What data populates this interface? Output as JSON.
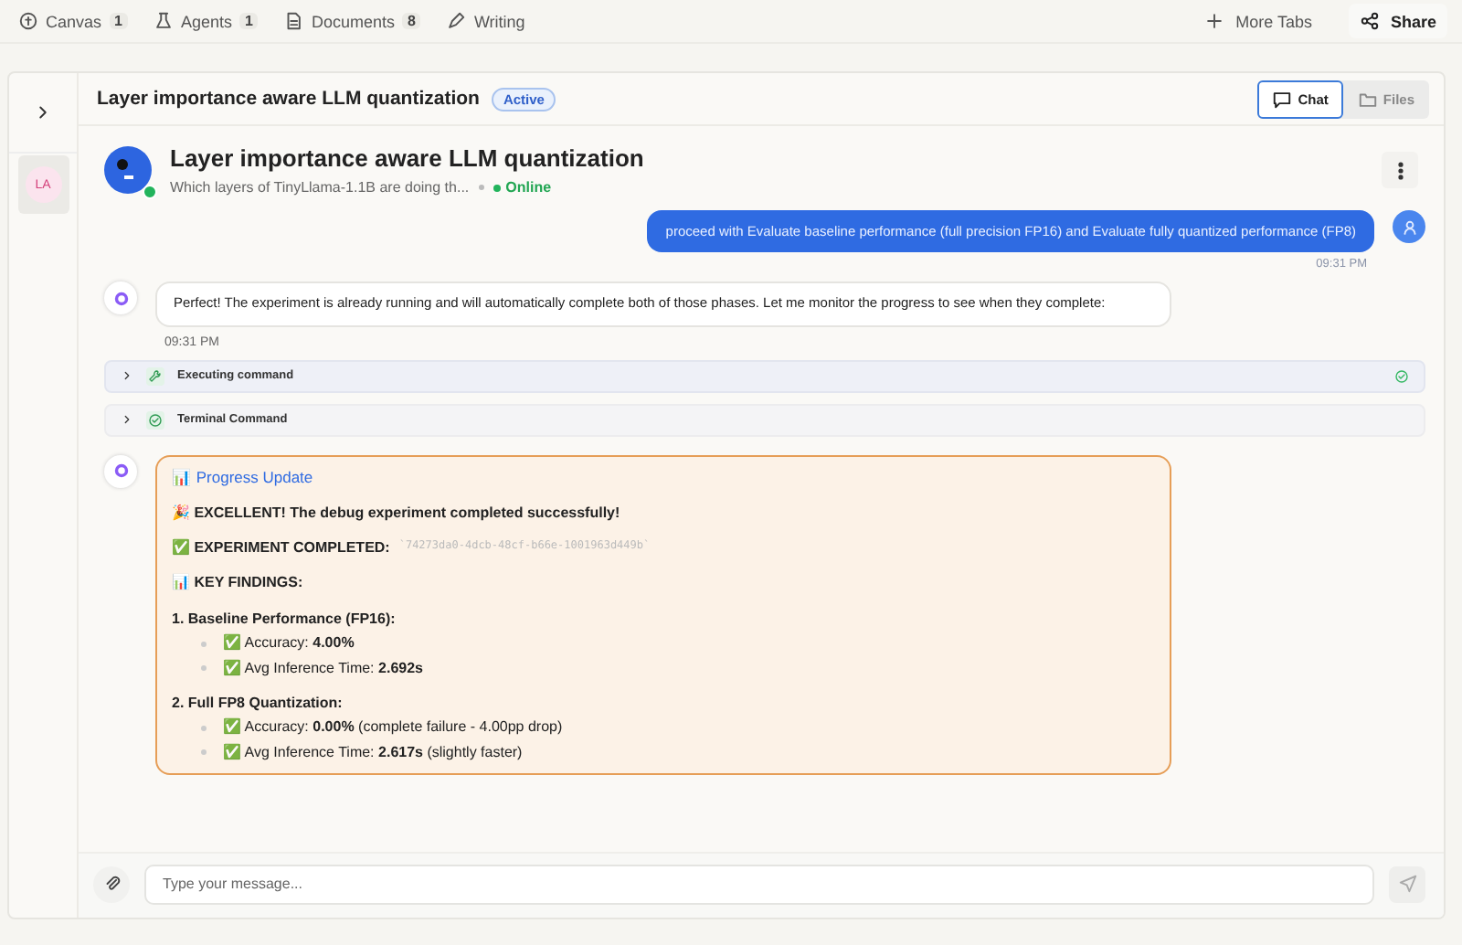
{
  "top_tabs": [
    {
      "label": "Canvas",
      "count": "1"
    },
    {
      "label": "Agents",
      "count": "1"
    },
    {
      "label": "Documents",
      "count": "8"
    },
    {
      "label": "Writing"
    }
  ],
  "top_actions": [
    {
      "label": "More Tabs"
    },
    {
      "label": "Share"
    }
  ],
  "chat_panel": {
    "title": "Layer importance aware LLM quantization",
    "badge": "Active",
    "sidebar_avatar": "LA",
    "view_tabs": [
      {
        "label": "Chat",
        "selected": true
      },
      {
        "label": "Files",
        "selected": false
      }
    ],
    "agent": {
      "name": "Layer importance aware LLM quantization",
      "subtitle": "Which layers of TinyLlama-1.1B are doing th...",
      "status": "Online"
    },
    "messages": [
      {
        "kind": "user",
        "text": "proceed with Evaluate baseline performance (full precision FP16)  and Evaluate fully quantized performance (FP8)",
        "time": "09:31 PM"
      },
      {
        "kind": "assistant",
        "text": "Perfect! The experiment is already running and will automatically complete both of those phases. Let me monitor the progress to see when they complete:",
        "time": "09:31 PM"
      },
      {
        "kind": "command",
        "label": "Executing command",
        "done": true
      },
      {
        "kind": "terminal",
        "label": "Terminal Command",
        "done": false
      },
      {
        "kind": "report",
        "title": "📊 Progress Update",
        "blocks": [
          {
            "kind": "para",
            "text": "🎉 EXCELLENT! The debug experiment completed successfully!"
          },
          {
            "kind": "para",
            "text": "✅ EXPERIMENT COMPLETED:",
            "code": "`74273da0-4dcb-48cf-b66e-1001963d449b`"
          },
          {
            "kind": "para",
            "text": "📊 KEY FINDINGS:"
          },
          {
            "kind": "para",
            "text": "1. Baseline Performance (FP16):"
          },
          {
            "kind": "bullet",
            "text": "✅ Accuracy: **4.00%**"
          },
          {
            "kind": "bullet",
            "text": "✅ Avg Inference Time: **2.692s**"
          },
          {
            "kind": "para",
            "text": "2. Full FP8 Quantization:"
          },
          {
            "kind": "bullet",
            "text": "✅ Accuracy: **0.00%** (complete failure - 4.00pp drop)"
          },
          {
            "kind": "bullet",
            "text": "✅ Avg Inference Time: **2.617s** (slightly faster)"
          }
        ]
      }
    ],
    "composer": {
      "placeholder": "Type your message..."
    }
  }
}
